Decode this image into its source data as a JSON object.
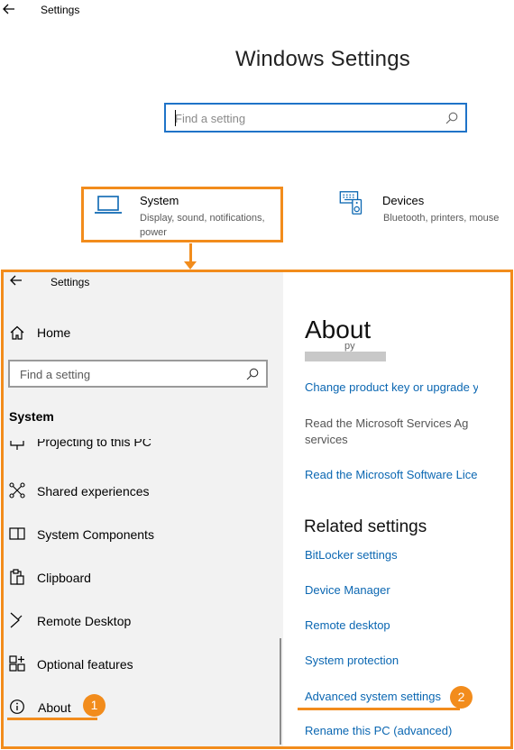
{
  "top_window": {
    "title": "Settings",
    "heading": "Windows Settings",
    "search": {
      "placeholder": "Find a setting"
    },
    "tiles": [
      {
        "title": "System",
        "subtitle_line1": "Display, sound, notifications,",
        "subtitle_line2": "power",
        "icon": "laptop-icon"
      },
      {
        "title": "Devices",
        "subtitle_line1": "Bluetooth, printers, mouse",
        "icon": "devices-icon"
      }
    ]
  },
  "bottom_window": {
    "title": "Settings",
    "home_label": "Home",
    "search": {
      "placeholder": "Find a setting"
    },
    "section_label": "System",
    "nav_items": [
      {
        "label": "Projecting to this PC",
        "icon": "projecting-icon"
      },
      {
        "label": "Shared experiences",
        "icon": "shared-experiences-icon"
      },
      {
        "label": "System Components",
        "icon": "system-components-icon"
      },
      {
        "label": "Clipboard",
        "icon": "clipboard-icon"
      },
      {
        "label": "Remote Desktop",
        "icon": "remote-desktop-icon"
      },
      {
        "label": "Optional features",
        "icon": "optional-features-icon"
      },
      {
        "label": "About",
        "icon": "info-icon"
      }
    ],
    "about": {
      "heading": "About",
      "redacted_fragment": "py",
      "links_top": [
        "Change product key or upgrade your edition of Windows",
        "Read the Microsoft Services Agreement that applies to our services",
        "Read the Microsoft Software License Terms"
      ],
      "services_text_line1": "Read the Microsoft Services Ag",
      "services_text_line2": "services",
      "related_heading": "Related settings",
      "related_links": [
        "BitLocker settings",
        "Device Manager",
        "Remote desktop",
        "System protection",
        "Advanced system settings",
        "Rename this PC (advanced)"
      ]
    }
  },
  "annotations": {
    "badge_1": "1",
    "badge_2": "2",
    "accent_color": "#f28c1c",
    "link_color": "#0b67b2"
  }
}
